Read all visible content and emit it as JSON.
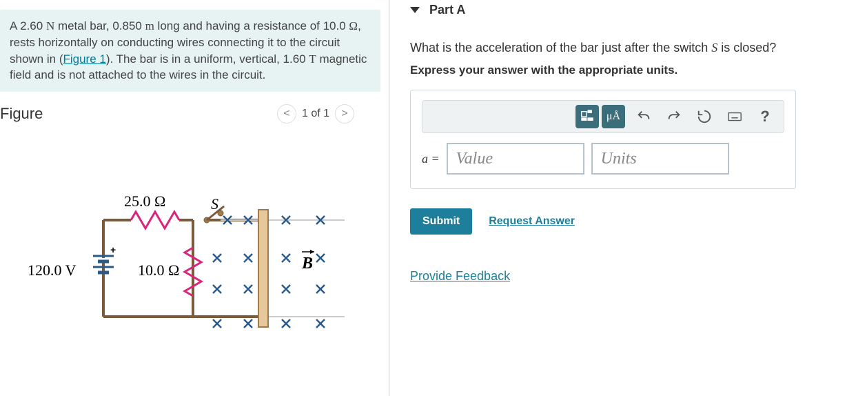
{
  "problem": {
    "text_parts": {
      "p1": "A 2.60 ",
      "u1": "N",
      "p2": " metal bar, 0.850 ",
      "u2": "m",
      "p3": " long and having a resistance of 10.0 ",
      "u3": "Ω",
      "p4": ", rests horizontally on conducting wires connecting it to the circuit shown in (",
      "link": "Figure 1",
      "p5": "). The bar is in a uniform, vertical, 1.60 ",
      "u4": "T",
      "p6": " magnetic field and is not attached to the wires in the circuit."
    }
  },
  "figure": {
    "title": "Figure",
    "pager": "1 of 1",
    "labels": {
      "r1": "25.0 Ω",
      "r2": "10.0 Ω",
      "v": "120.0 V",
      "s": "S",
      "b": "B⃗"
    }
  },
  "partA": {
    "title": "Part A",
    "question": "What is the acceleration of the bar just after the switch S is closed?",
    "instruction": "Express your answer with the appropriate units.",
    "eq_label": "a =",
    "value_placeholder": "Value",
    "units_placeholder": "Units",
    "submit": "Submit",
    "request": "Request Answer",
    "toolbar": {
      "units_icon": "μÅ",
      "help": "?"
    }
  },
  "feedback": "Provide Feedback"
}
